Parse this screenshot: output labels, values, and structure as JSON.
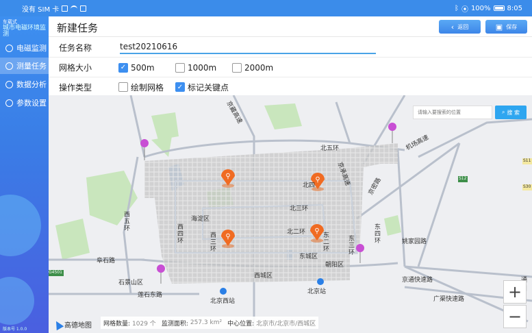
{
  "statusbar": {
    "carrier": "没有 SIM 卡",
    "battery": "100%",
    "time": "8:05"
  },
  "sidebar": {
    "brand_line1": "车载式",
    "brand_line2": "城市电磁环境监测",
    "items": [
      {
        "label": "电磁监测",
        "icon": "monitor-icon"
      },
      {
        "label": "测量任务",
        "icon": "task-icon"
      },
      {
        "label": "数据分析",
        "icon": "analysis-icon"
      },
      {
        "label": "参数设置",
        "icon": "settings-icon"
      }
    ],
    "version": "版本号 1.0.0"
  },
  "header": {
    "title": "新建任务",
    "back_label": "返回",
    "save_label": "保存"
  },
  "form": {
    "name_label": "任务名称",
    "name_value": "test20210616",
    "grid_label": "网格大小",
    "grid_options": [
      "500m",
      "1000m",
      "2000m"
    ],
    "grid_selected": "500m",
    "op_label": "操作类型",
    "op_options": [
      "绘制网格",
      "标记关键点"
    ],
    "op_selected": "标记关键点"
  },
  "map": {
    "search_placeholder": "请输入要搜索的位置",
    "search_label": "搜 索",
    "logo": "高德地图",
    "zoom_in": "+",
    "zoom_out": "−",
    "stats": {
      "count_label": "网格数量:",
      "count_value": "1029 个",
      "area_label": "监测面积:",
      "area_value": "257.3 km²",
      "center_label": "中心位置:",
      "center_value": "北京市/北京市/西城区"
    },
    "labels": {
      "north5": "北五环",
      "north3": "北三环",
      "north2": "北二环",
      "north4_short": "北四",
      "west5": "西五环",
      "west4": "西四环",
      "west3": "西三环",
      "east4": "东四环",
      "east3": "东三环",
      "east2": "东二环",
      "haidian": "海淀区",
      "xicheng": "西城区",
      "dongcheng": "东城区",
      "chaoyang": "朝阳区",
      "fushi": "阜石路",
      "shijingshan": "石景山区",
      "lianshi": "莲石东路",
      "bjwest": "北京西站",
      "bjstation": "北京站",
      "jingcheng": "京承高速",
      "jichang": "机场高速",
      "jingmi": "京密路",
      "yaojia": "姚家园路",
      "jingtong": "京通快速路",
      "guangqu": "广渠快速路",
      "tongzhou": "通州",
      "g4501": "G4501",
      "s12": "S12",
      "s30": "S30",
      "s11": "S11",
      "jingchengroad": "京藏高速"
    }
  }
}
